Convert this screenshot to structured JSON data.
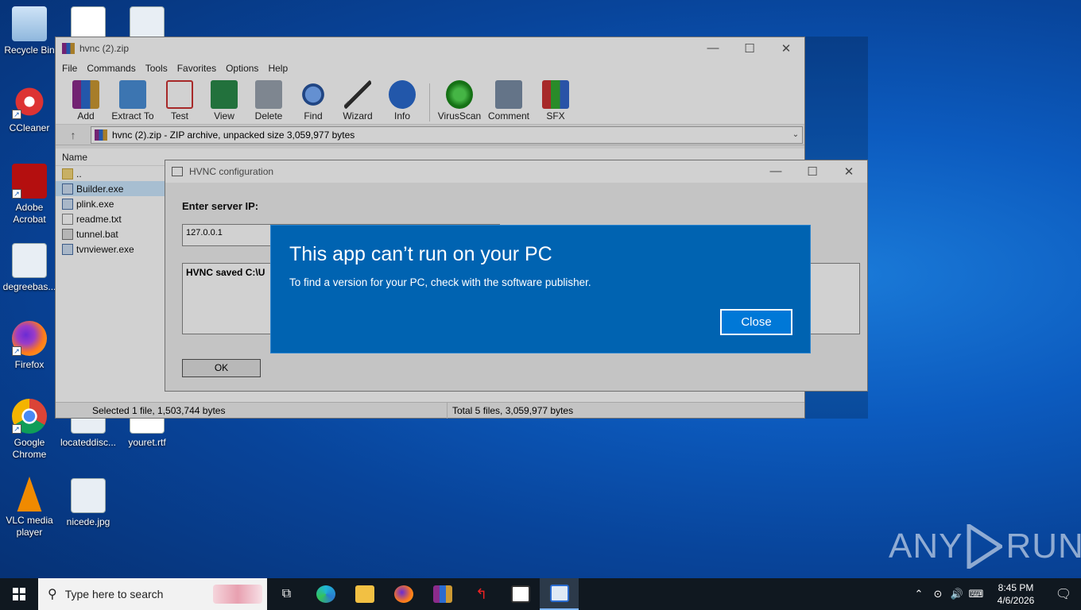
{
  "desktop": {
    "icons": [
      {
        "label": "Recycle Bin"
      },
      {
        "label": "CCleaner"
      },
      {
        "label": "Adobe Acrobat"
      },
      {
        "label": "degreebas..."
      },
      {
        "label": "Firefox"
      },
      {
        "label": "Google Chrome"
      },
      {
        "label": "VLC media player"
      },
      {
        "label": "locateddisc..."
      },
      {
        "label": "youret.rtf"
      },
      {
        "label": "nicede.jpg"
      }
    ]
  },
  "winrar": {
    "title": "hvnc (2).zip",
    "menu": [
      "File",
      "Commands",
      "Tools",
      "Favorites",
      "Options",
      "Help"
    ],
    "toolbar": [
      "Add",
      "Extract To",
      "Test",
      "View",
      "Delete",
      "Find",
      "Wizard",
      "Info",
      "VirusScan",
      "Comment",
      "SFX"
    ],
    "address": "hvnc (2).zip - ZIP archive, unpacked size 3,059,977 bytes",
    "column_name": "Name",
    "files": [
      "..",
      "Builder.exe",
      "plink.exe",
      "readme.txt",
      "tunnel.bat",
      "tvnviewer.exe"
    ],
    "status_left": "Selected 1 file, 1,503,744 bytes",
    "status_right": "Total 5 files, 3,059,977 bytes"
  },
  "hvnc": {
    "title": "HVNC configuration",
    "label": "Enter server IP:",
    "ip_value": "127.0.0.1",
    "log_text": "HVNC saved C:\\U",
    "ok_label": "OK"
  },
  "error_dialog": {
    "title": "This app can’t run on your PC",
    "message": "To find a version for your PC, check with the software publisher.",
    "close_label": "Close"
  },
  "watermark": {
    "left": "ANY",
    "right": "RUN"
  },
  "taskbar": {
    "search_placeholder": "Type here to search",
    "time": "8:45 PM",
    "date": "4/6/2026"
  }
}
